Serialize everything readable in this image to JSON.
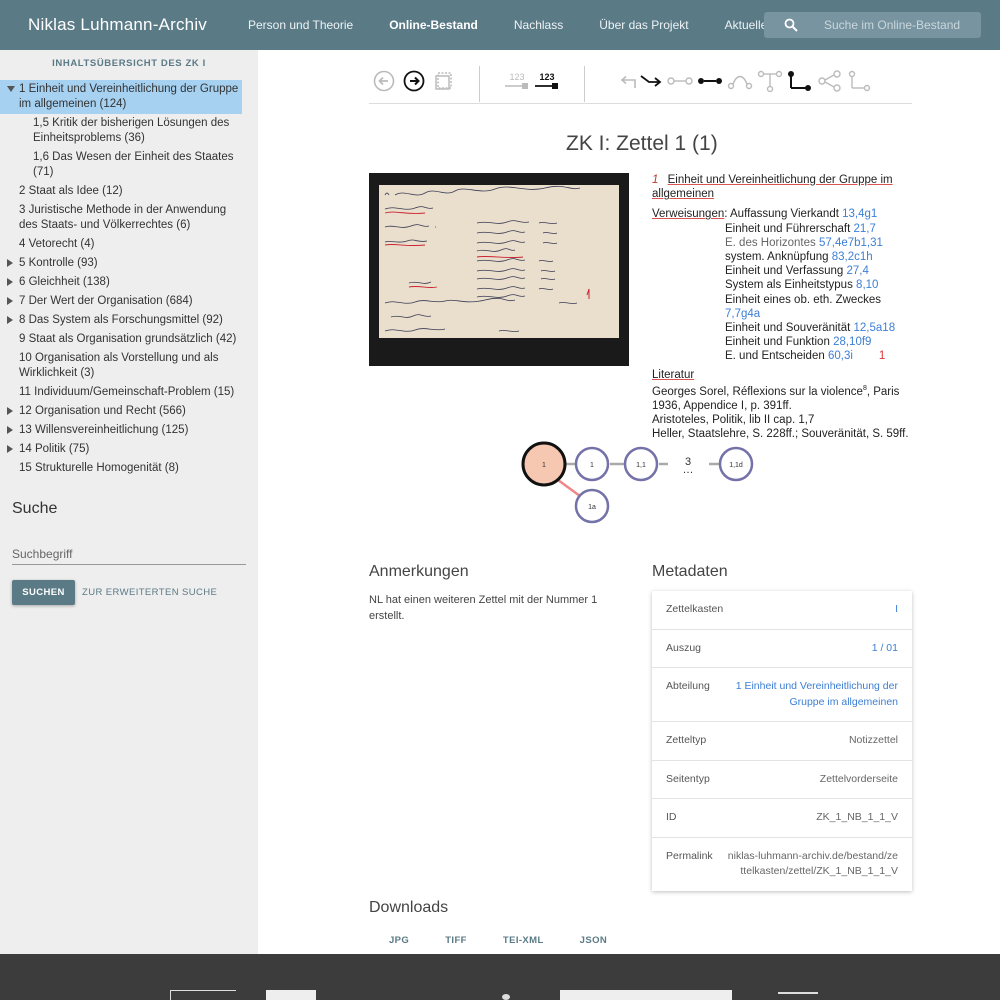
{
  "header": {
    "brand": "Niklas Luhmann-Archiv",
    "nav": [
      "Person und Theorie",
      "Online-Bestand",
      "Nachlass",
      "Über das Projekt",
      "Aktuelles"
    ],
    "active_nav": "Online-Bestand",
    "search_placeholder": "Suche im Online-Bestand"
  },
  "sidebar": {
    "heading": "INHALTSÜBERSICHT DES ZK I",
    "items": [
      {
        "label": "1 Einheit und Vereinheitlichung der Gruppe im allgemeinen (124)",
        "arrow": "down",
        "selected": true
      },
      {
        "label": "1,5 Kritik der bisherigen Lösungen des Einheitsproblems (36)",
        "sub": true
      },
      {
        "label": "1,6 Das Wesen der Einheit des Staates (71)",
        "sub": true
      },
      {
        "label": "2 Staat als Idee (12)"
      },
      {
        "label": "3 Juristische Methode in der Anwendung des Staats- und Völkerrechtes (6)"
      },
      {
        "label": "4 Vetorecht (4)"
      },
      {
        "label": "5 Kontrolle (93)",
        "arrow": "right"
      },
      {
        "label": "6 Gleichheit (138)",
        "arrow": "right"
      },
      {
        "label": "7 Der Wert der Organisation (684)",
        "arrow": "right"
      },
      {
        "label": "8 Das System als Forschungsmittel (92)",
        "arrow": "right"
      },
      {
        "label": "9 Staat als Organisation grundsätzlich (42)"
      },
      {
        "label": "10 Organisation als Vorstellung und als Wirklichkeit (3)"
      },
      {
        "label": "11 Individuum/Gemeinschaft-Problem (15)"
      },
      {
        "label": "12 Organisation und Recht (566)",
        "arrow": "right"
      },
      {
        "label": "13 Willensvereinheitlichung (125)",
        "arrow": "right"
      },
      {
        "label": "14 Politik (75)",
        "arrow": "right"
      },
      {
        "label": "15 Strukturelle Homogenität (8)"
      }
    ],
    "search_title": "Suche",
    "search_placeholder": "Suchbegriff",
    "search_button": "SUCHEN",
    "advanced_link": "ZUR ERWEITERTEN SUCHE"
  },
  "toolbar": {
    "num_left": "123",
    "num_right": "123"
  },
  "zettel": {
    "title": "ZK I: Zettel 1 (1)",
    "heading_num": "1",
    "heading": "Einheit und Vereinheitlichung der Gruppe im allgemeinen",
    "verweisungen_label": "Verweisungen",
    "refs": [
      {
        "text": "Auffassung Vierkandt",
        "link": "13,4g1"
      },
      {
        "text": "Einheit und Führerschaft",
        "link": "21,7"
      },
      {
        "text": "E. des Horizontes",
        "link": "57,4e7b1,31",
        "grey": true
      },
      {
        "text": "system. Anknüpfung",
        "link": "83,2c1h"
      },
      {
        "text": "Einheit und Verfassung",
        "link": "27,4"
      },
      {
        "text": "System als Einheitstypus",
        "link": "8,10"
      },
      {
        "text": "Einheit eines ob. eth. Zweckes",
        "link": "7,7g4a"
      },
      {
        "text": "Einheit und Souveränität",
        "link": "12,5a18"
      },
      {
        "text": "Einheit und Funktion",
        "link": "28,10f9"
      },
      {
        "text": "E. und Entscheiden",
        "link": "60,3i",
        "mark": "1"
      }
    ],
    "literatur_label": "Literatur",
    "literatur": [
      "Georges Sorel, Réflexions sur la violence",
      "8",
      ", Paris 1936, Appendice I, p. 391ff.",
      "Aristoteles, Politik, lib II cap. 1,7",
      "Heller, Staatslehre, S. 228ff.; Souveränität, S. 59ff."
    ]
  },
  "graph": {
    "nodes": [
      "1",
      "1",
      "1,1",
      "3",
      "1,1d",
      "1a"
    ]
  },
  "anmerkungen": {
    "title": "Anmerkungen",
    "text": "NL hat einen weiteren Zettel mit der Nummer 1 erstellt."
  },
  "metadaten": {
    "title": "Metadaten",
    "rows": [
      {
        "key": "Zettelkasten",
        "value": "I",
        "link": true
      },
      {
        "key": "Auszug",
        "value": "1 / 01",
        "link": true
      },
      {
        "key": "Abteilung",
        "value": "1 Einheit und Vereinheitlichung der Gruppe im allgemeinen",
        "link": true
      },
      {
        "key": "Zetteltyp",
        "value": "Notizzettel"
      },
      {
        "key": "Seitentyp",
        "value": "Zettelvorderseite"
      },
      {
        "key": "ID",
        "value": "ZK_1_NB_1_1_V"
      },
      {
        "key": "Permalink",
        "value": "niklas-luhmann-archiv.de/bestand/zettelkasten/zettel/ZK_1_NB_1_1_V"
      }
    ]
  },
  "downloads": {
    "title": "Downloads",
    "items": [
      "JPG",
      "TIFF",
      "TEI-XML",
      "JSON"
    ]
  },
  "colors": {
    "header": "#5a7a86",
    "sidebar": "#eeeeee",
    "selected": "#a6d1f1",
    "link": "#3d7fd4",
    "node_current": "#f6c7b1",
    "node_ring": "#7472a8"
  }
}
